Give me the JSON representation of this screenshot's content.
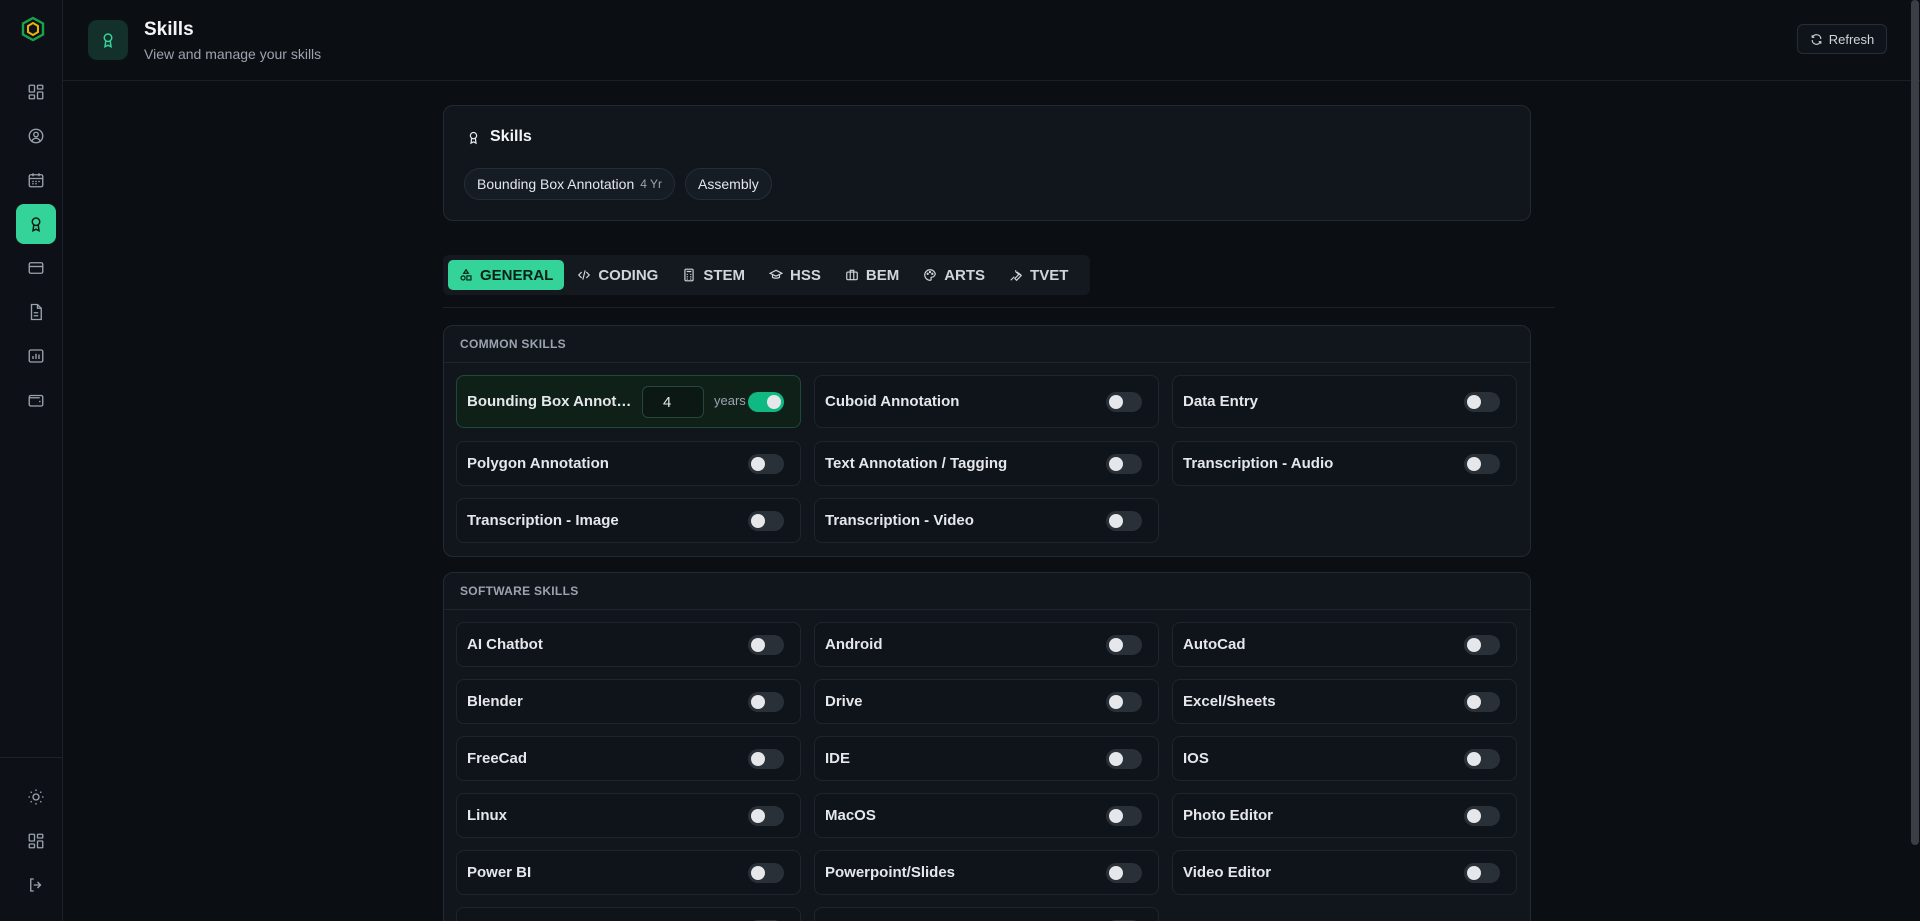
{
  "header": {
    "title": "Skills",
    "subtitle": "View and manage your skills",
    "refresh_label": "Refresh"
  },
  "sidebar": {
    "items": [
      {
        "name": "dashboard",
        "icon": "dashboard-icon"
      },
      {
        "name": "profile",
        "icon": "user-circle-icon"
      },
      {
        "name": "calendar",
        "icon": "calendar-icon"
      },
      {
        "name": "skills",
        "icon": "award-icon",
        "active": true
      },
      {
        "name": "payments",
        "icon": "credit-card-icon"
      },
      {
        "name": "documents",
        "icon": "document-icon"
      },
      {
        "name": "projects",
        "icon": "folder-chart-icon"
      },
      {
        "name": "wallet",
        "icon": "wallet-icon"
      }
    ],
    "bottom": [
      {
        "name": "theme",
        "icon": "sun-icon"
      },
      {
        "name": "apps",
        "icon": "grid-icon"
      },
      {
        "name": "logout",
        "icon": "logout-icon"
      }
    ]
  },
  "skills_card": {
    "title": "Skills",
    "chips": [
      {
        "label": "Bounding Box Annotation",
        "years": "4 Yr"
      },
      {
        "label": "Assembly",
        "years": ""
      }
    ]
  },
  "tabs": [
    {
      "label": "GENERAL",
      "icon": "shapes-icon",
      "active": true
    },
    {
      "label": "CODING",
      "icon": "code-icon"
    },
    {
      "label": "STEM",
      "icon": "calculator-icon"
    },
    {
      "label": "HSS",
      "icon": "graduation-cap-icon"
    },
    {
      "label": "BEM",
      "icon": "briefcase-icon"
    },
    {
      "label": "ARTS",
      "icon": "palette-icon"
    },
    {
      "label": "TVET",
      "icon": "wrench-icon"
    }
  ],
  "common": {
    "title": "COMMON SKILLS",
    "items": [
      {
        "label": "Bounding Box Annotati...",
        "on": true,
        "years": "4",
        "years_label": "years"
      },
      {
        "label": "Cuboid Annotation",
        "on": false
      },
      {
        "label": "Data Entry",
        "on": false
      },
      {
        "label": "Polygon Annotation",
        "on": false
      },
      {
        "label": "Text Annotation / Tagging",
        "on": false
      },
      {
        "label": "Transcription - Audio",
        "on": false
      },
      {
        "label": "Transcription - Image",
        "on": false
      },
      {
        "label": "Transcription - Video",
        "on": false
      }
    ]
  },
  "software": {
    "title": "SOFTWARE SKILLS",
    "items": [
      {
        "label": "AI Chatbot",
        "on": false
      },
      {
        "label": "Android",
        "on": false
      },
      {
        "label": "AutoCad",
        "on": false
      },
      {
        "label": "Blender",
        "on": false
      },
      {
        "label": "Drive",
        "on": false
      },
      {
        "label": "Excel/Sheets",
        "on": false
      },
      {
        "label": "FreeCad",
        "on": false
      },
      {
        "label": "IDE",
        "on": false
      },
      {
        "label": "IOS",
        "on": false
      },
      {
        "label": "Linux",
        "on": false
      },
      {
        "label": "MacOS",
        "on": false
      },
      {
        "label": "Photo Editor",
        "on": false
      },
      {
        "label": "Power BI",
        "on": false
      },
      {
        "label": "Powerpoint/Slides",
        "on": false
      },
      {
        "label": "Video Editor",
        "on": false
      }
    ]
  },
  "colors": {
    "accent": "#34d399",
    "background": "#0b0f14",
    "card": "#11161d"
  }
}
